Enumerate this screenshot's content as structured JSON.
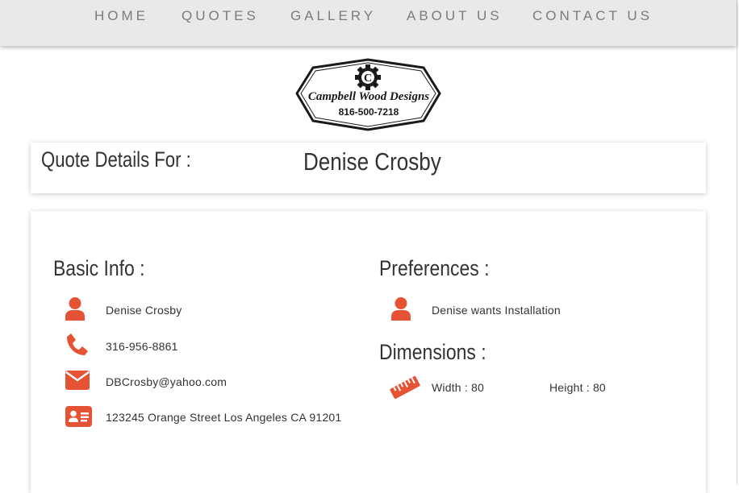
{
  "nav": {
    "items": [
      {
        "label": "HOME"
      },
      {
        "label": "QUOTES"
      },
      {
        "label": "GALLERY"
      },
      {
        "label": "ABOUT US"
      },
      {
        "label": "CONTACT US"
      }
    ]
  },
  "logo": {
    "letter": "C",
    "name": "Campbell Wood Designs",
    "phone": "816-500-7218"
  },
  "quote": {
    "label": "Quote Details For :",
    "customer_name": "Denise Crosby"
  },
  "basic_info": {
    "heading": "Basic Info :",
    "name": {
      "icon": "user-icon",
      "value": "Denise Crosby"
    },
    "phone": {
      "icon": "phone-icon",
      "value": "316-956-8861"
    },
    "email": {
      "icon": "envelope-icon",
      "value": "DBCrosby@yahoo.com"
    },
    "address": {
      "icon": "id-card-icon",
      "value": "123245 Orange Street Los Angeles CA 91201"
    }
  },
  "preferences": {
    "heading": "Preferences :",
    "installation": {
      "icon": "user-icon",
      "value": "Denise wants Installation"
    }
  },
  "dimensions": {
    "heading": "Dimensions :",
    "icon": "ruler-icon",
    "width": "Width : 80",
    "height": "Height : 80"
  },
  "colors": {
    "accent": "#e55234",
    "nav_bg": "#e9e9e9",
    "nav_text": "#7b7b7b",
    "text": "#333333"
  }
}
